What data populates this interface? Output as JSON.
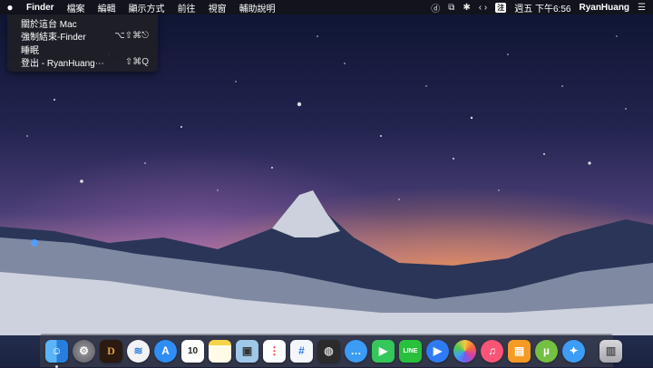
{
  "menubar": {
    "apple_icon": "apple-icon",
    "app_name": "Finder",
    "items": [
      "檔案",
      "編輯",
      "顯示方式",
      "前往",
      "視窗",
      "輔助說明"
    ],
    "ime": "注",
    "clock": "週五 下午6:56",
    "user": "RyanHuang"
  },
  "apple_menu": {
    "items": [
      {
        "label": "關於這台 Mac",
        "shortcut": ""
      },
      {
        "label": "強制結束-Finder",
        "shortcut": "⌥⇧⌘⎋"
      },
      {
        "label": "睡眠",
        "shortcut": ""
      },
      {
        "label": "登出 - RyanHuang⋯",
        "shortcut": "⇧⌘Q"
      }
    ]
  },
  "dock": {
    "calendar_day": "10",
    "apps": [
      "finder",
      "system-preferences",
      "diablo",
      "wifi-diagnostics",
      "app-store",
      "calendar",
      "notes",
      "preview",
      "reminders",
      "numbers",
      "photo-booth",
      "messages",
      "facetime",
      "line",
      "quicktime",
      "photos",
      "itunes",
      "ibooks",
      "utorrent",
      "safari",
      "trash"
    ]
  },
  "colors": {
    "menubar": "#141418",
    "accent": "#2f7bf5"
  }
}
